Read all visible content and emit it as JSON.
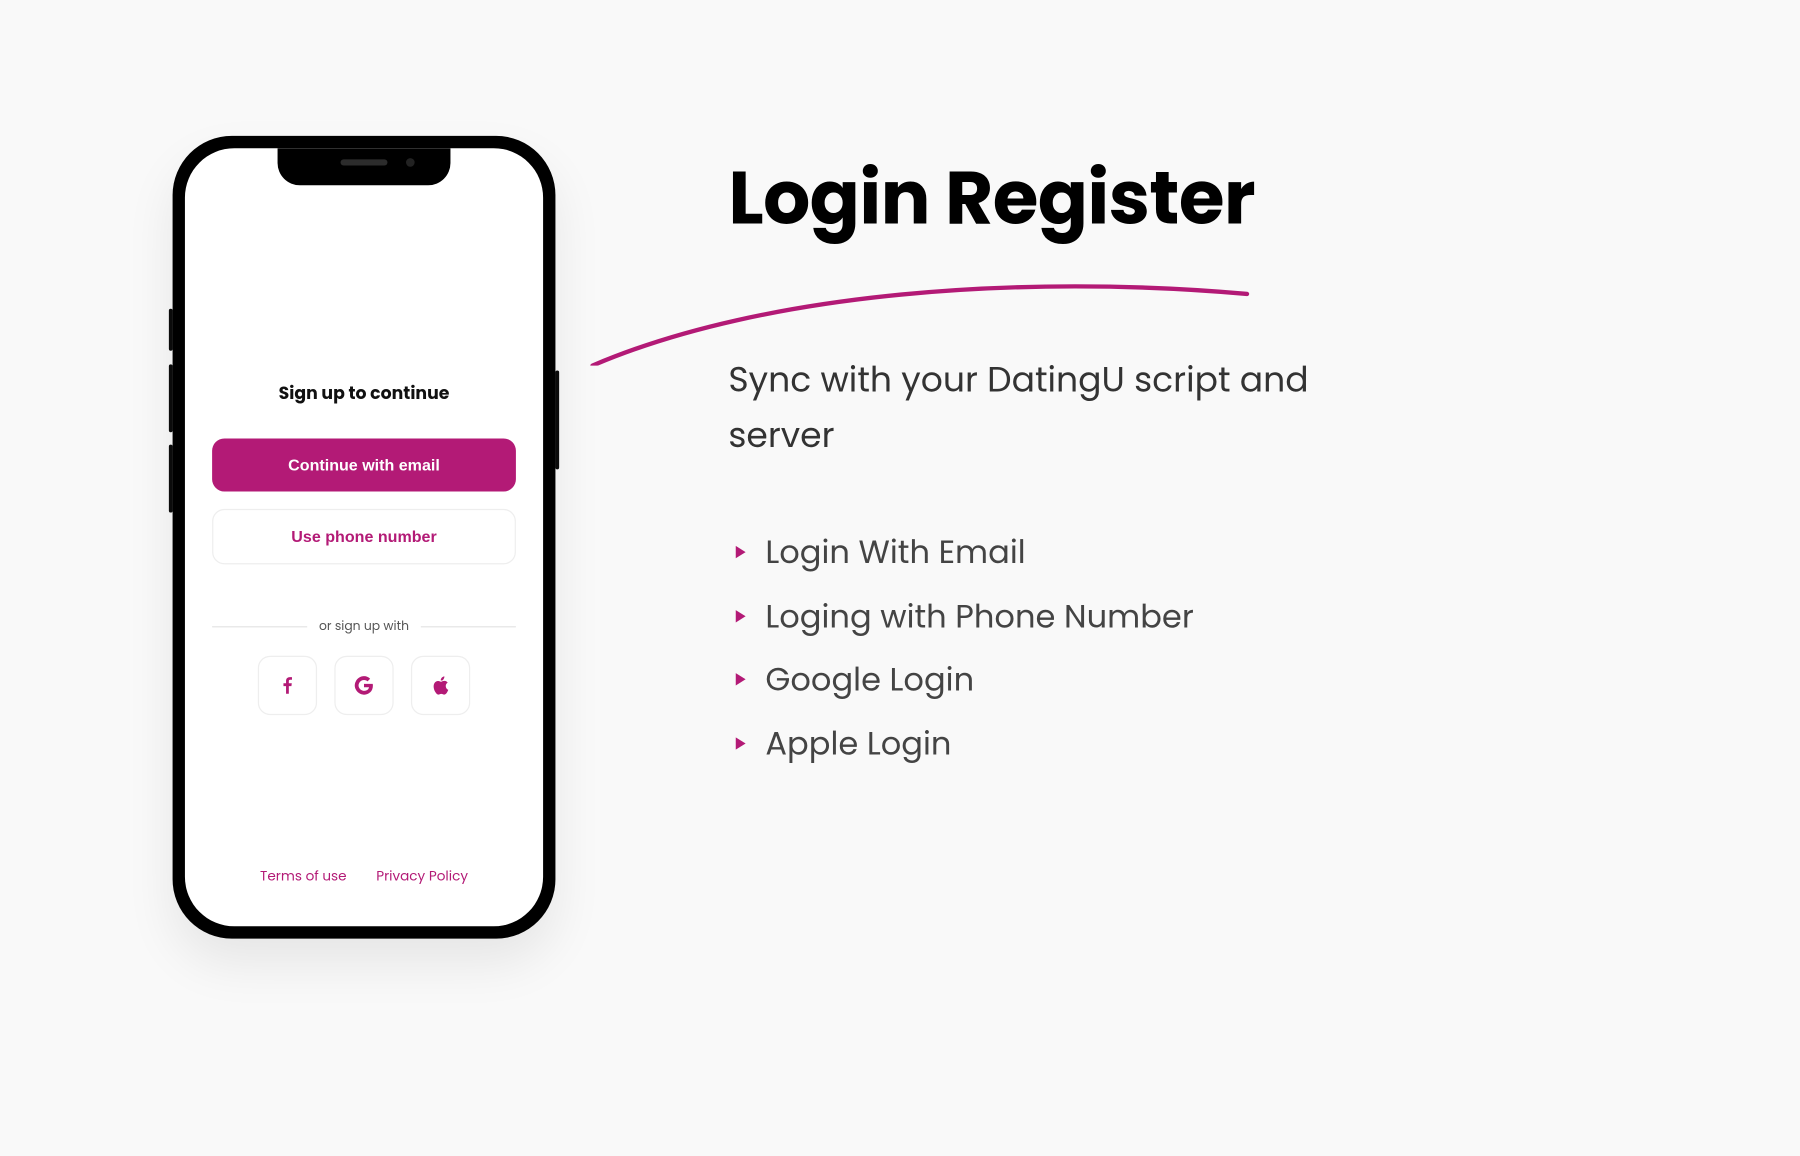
{
  "colors": {
    "accent": "#b31a76"
  },
  "phone": {
    "title": "Sign up to continue",
    "primary_button": "Continue with email",
    "secondary_button": "Use phone number",
    "or_label": "or sign up with",
    "social": {
      "facebook": "facebook-icon",
      "google": "google-icon",
      "apple": "apple-icon"
    },
    "terms": "Terms of use",
    "privacy": "Privacy Policy"
  },
  "right": {
    "headline": "Login Register",
    "subhead": "Sync with your DatingU script and server",
    "features": [
      "Login With Email",
      "Loging with Phone Number",
      "Google Login",
      "Apple Login"
    ]
  }
}
